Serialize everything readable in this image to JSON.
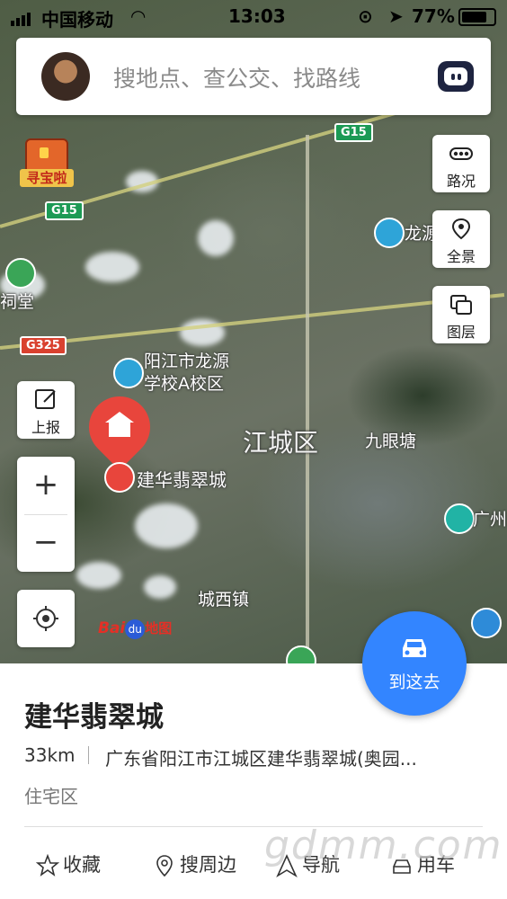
{
  "status_bar": {
    "carrier": "中国移动",
    "time": "13:03",
    "battery": "77%"
  },
  "search": {
    "placeholder": "搜地点、查公交、找路线"
  },
  "map_tools": {
    "traffic": "路况",
    "panorama": "全景",
    "layers": "图层",
    "report": "上报"
  },
  "treasure_label": "寻宝啦",
  "map_labels": {
    "poi_school": "阳江市龙源\n学校A校区",
    "district": "江城区",
    "jiuyantang": "九眼塘",
    "chengxi": "城西镇",
    "longyuan": "龙源",
    "guangzhou": "广州",
    "citang": "祠堂",
    "selected_poi": "建华翡翠城"
  },
  "highways": [
    "G15",
    "G15",
    "G325"
  ],
  "logo": {
    "bai": "Bai",
    "du": "du",
    "map": "地图"
  },
  "goto_button": {
    "label": "到这去"
  },
  "place": {
    "name": "建华翡翠城",
    "distance": "33km",
    "address": "广东省阳江市江城区建华翡翠城(奥园...",
    "category": "住宅区"
  },
  "actions": {
    "favorite": "收藏",
    "nearby": "搜周边",
    "navigate": "导航",
    "car": "用车"
  },
  "watermark": "gdmm.com",
  "colors": {
    "accent": "#3385ff",
    "pin": "#e8453c"
  }
}
